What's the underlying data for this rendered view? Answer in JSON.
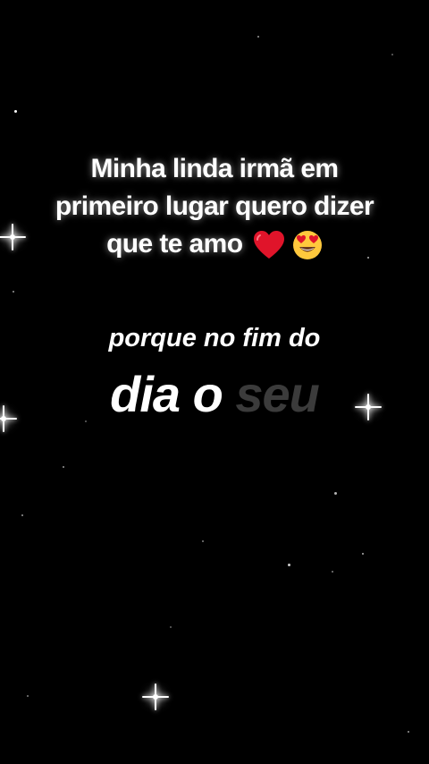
{
  "intro": {
    "line1": "Minha linda irmã em",
    "line2": "primeiro lugar quero dizer",
    "line3": "que te amo",
    "emojis": [
      "red-heart",
      "heart-eyes-face"
    ]
  },
  "lyrics": {
    "line1": "porque no fim do",
    "line2_highlighted": "dia o",
    "line2_dim": "seu"
  },
  "colors": {
    "background": "#000000",
    "text": "#ffffff",
    "dim_text": "#3b3b3b",
    "heart": "#e0142a",
    "emoji_face": "#ffc83d"
  }
}
